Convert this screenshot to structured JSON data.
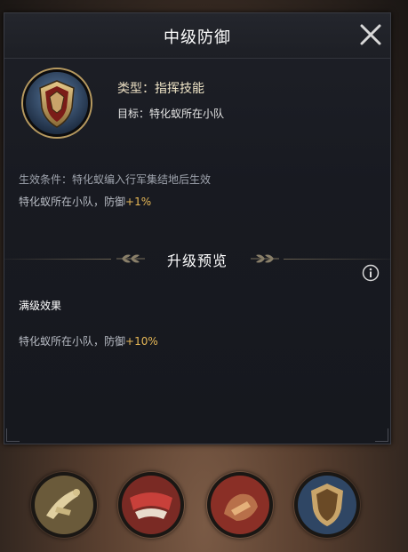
{
  "dialog": {
    "title": "中级防御",
    "type_label": "类型：",
    "type_value": "指挥技能",
    "target": "目标：特化蚁所在小队",
    "condition": "生效条件：特化蚁编入行军集结地后生效",
    "effect_prefix": "特化蚁所在小队，防御",
    "effect_value": "+1%",
    "upgrade_preview_title": "升级预览",
    "max_level_label": "满级效果",
    "max_effect_prefix": "特化蚁所在小队，防御",
    "max_effect_value": "+10%"
  },
  "colors": {
    "highlight": "#e8b957",
    "title": "#ffffff",
    "panel_bg": "#1a1c22"
  },
  "icons": {
    "close": "close-icon",
    "skill": "shield-icon",
    "info": "info-icon",
    "bottom_skills": [
      "claw-skill-icon",
      "red-attack-skill-icon",
      "red-strength-skill-icon",
      "shield-skill-icon"
    ]
  }
}
